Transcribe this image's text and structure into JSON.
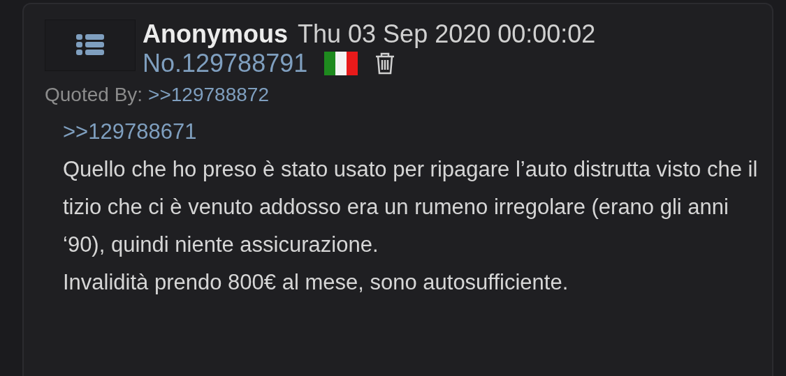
{
  "post": {
    "name": "Anonymous",
    "datetime": "Thu 03 Sep 2020 00:00:02",
    "number": "No.129788791",
    "quoted_by_label": "Quoted By:",
    "quoted_by": [
      ">>129788872"
    ],
    "quote_link": ">>129788671",
    "paragraphs": [
      "Quello che ho preso è stato usato per ripagare l’auto distrutta visto che il tizio che ci è venuto addosso era un rumeno irregolare (erano gli anni ‘90), quindi niente assicurazione.",
      "Invalidità prendo 800€ al mese, sono autosufficiente."
    ]
  }
}
